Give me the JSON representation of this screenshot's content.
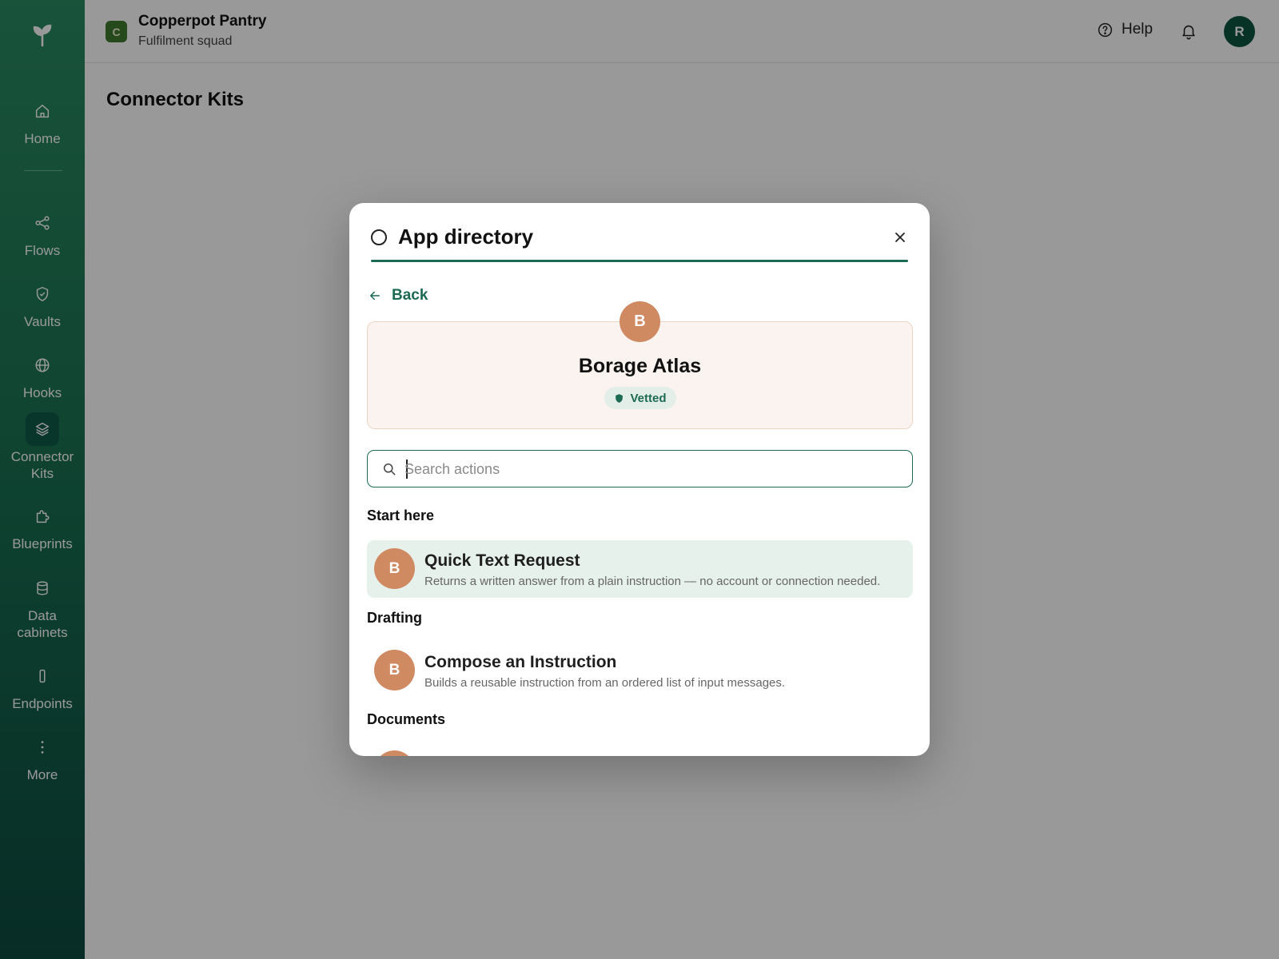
{
  "org": {
    "badge": "C",
    "name": "Copperpot Pantry",
    "subtitle": "Fulfilment squad"
  },
  "topbar": {
    "help_label": "Help",
    "user_initial": "R"
  },
  "sidebar": {
    "items": [
      {
        "label": "Home",
        "icon": "home-icon"
      },
      {
        "label": "Flows",
        "icon": "share-icon"
      },
      {
        "label": "Vaults",
        "icon": "shield-check-icon"
      },
      {
        "label": "Hooks",
        "icon": "globe-icon"
      },
      {
        "label": "Connector Kits",
        "icon": "layers-icon",
        "active": true
      },
      {
        "label": "Blueprints",
        "icon": "puzzle-icon"
      },
      {
        "label": "Data cabinets",
        "icon": "database-icon"
      },
      {
        "label": "Endpoints",
        "icon": "device-icon"
      },
      {
        "label": "More",
        "icon": "dots-vertical-icon"
      }
    ]
  },
  "page": {
    "title": "Connector Kits"
  },
  "modal": {
    "title": "App directory",
    "back_label": "Back",
    "app": {
      "initial": "B",
      "name": "Borage Atlas",
      "badge": "Vetted"
    },
    "search": {
      "placeholder": "Search actions",
      "value": ""
    },
    "sections": [
      {
        "title": "Start here",
        "actions": [
          {
            "initial": "B",
            "title": "Quick Text Request",
            "description": "Returns a written answer from a plain instruction — no account or connection needed.",
            "highlighted": true
          }
        ]
      },
      {
        "title": "Drafting",
        "actions": [
          {
            "initial": "B",
            "title": "Compose an Instruction",
            "description": "Builds a reusable instruction from an ordered list of input messages."
          }
        ]
      },
      {
        "title": "Documents",
        "actions": []
      }
    ]
  },
  "colors": {
    "accent": "#1c6a54",
    "app_avatar": "#d08a62",
    "sidebar_top": "#2a8a62",
    "sidebar_bottom": "#0c4a3f"
  }
}
